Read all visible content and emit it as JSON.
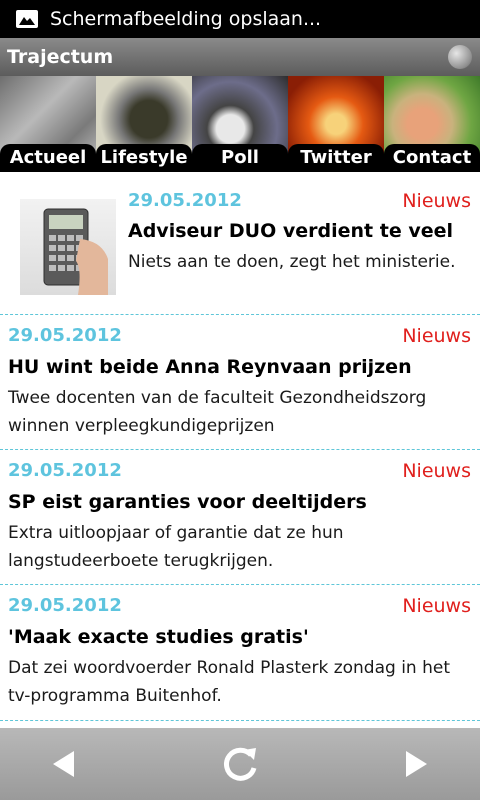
{
  "status": {
    "notification": "Schermafbeelding opslaan...",
    "icon": "image-icon"
  },
  "app": {
    "title": "Trajectum"
  },
  "tabs": [
    {
      "label": "Actueel"
    },
    {
      "label": "Lifestyle"
    },
    {
      "label": "Poll"
    },
    {
      "label": "Twitter"
    },
    {
      "label": "Contact"
    }
  ],
  "news": [
    {
      "date": "29.05.2012",
      "category": "Nieuws",
      "title": "Adviseur DUO verdient te veel",
      "summary": "Niets aan te doen, zegt het ministerie.",
      "thumbnail": "calculator"
    },
    {
      "date": "29.05.2012",
      "category": "Nieuws",
      "title": "HU wint beide Anna Reynvaan prijzen",
      "summary": "Twee docenten van de faculteit Gezondheidszorg winnen verpleegkundigeprijzen"
    },
    {
      "date": "29.05.2012",
      "category": "Nieuws",
      "title": "SP eist garanties voor deeltijders",
      "summary": "Extra uitloopjaar of garantie dat ze hun langstudeerboete terugkrijgen."
    },
    {
      "date": "29.05.2012",
      "category": "Nieuws",
      "title": "'Maak exacte studies gratis'",
      "summary": "Dat zei woordvoerder Ronald Plasterk zondag in het tv-programma Buitenhof."
    }
  ],
  "toolbar": {
    "back_icon": "back-arrow-icon",
    "refresh_icon": "refresh-icon",
    "forward_icon": "forward-arrow-icon"
  },
  "colors": {
    "date": "#5ec4de",
    "category": "#e0201d",
    "divider": "#5fc6d8"
  }
}
